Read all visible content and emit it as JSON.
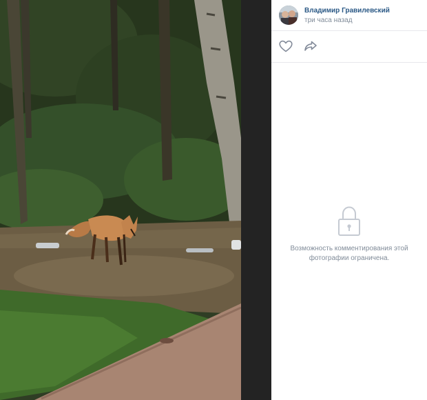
{
  "post": {
    "author": "Владимир Гравилевский",
    "time": "три часа назад"
  },
  "icons": {
    "like": "heart-icon",
    "share": "share-arrow-icon",
    "lock": "lock-icon"
  },
  "comments": {
    "restricted_text": "Возможность комментирования этой фотографии ограничена."
  },
  "colors": {
    "author_link": "#2a5885",
    "secondary_text": "#818c99",
    "icon": "#828a99",
    "separator": "#e7e8ec"
  }
}
